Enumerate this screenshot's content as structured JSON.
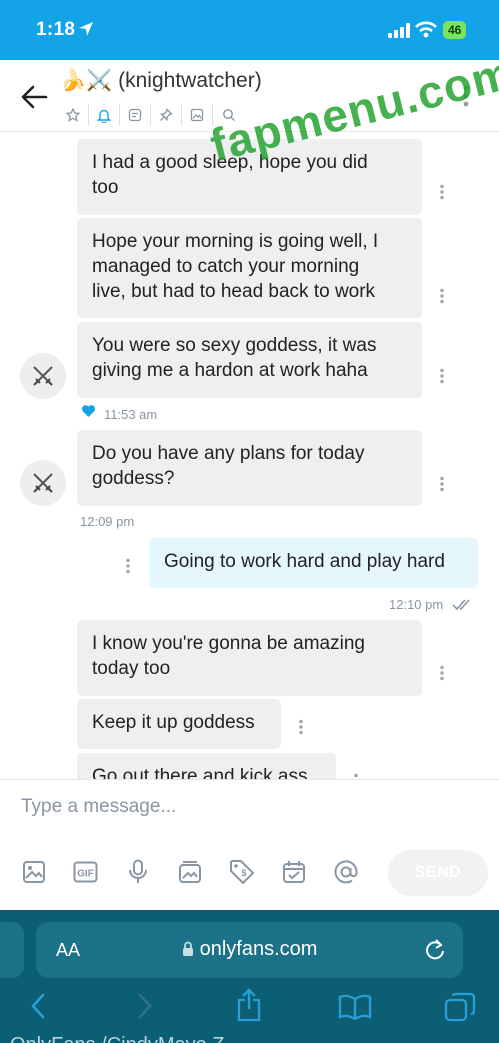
{
  "status": {
    "time": "1:18",
    "network": "46"
  },
  "header": {
    "title": "🍌⚔️ (knightwatcher)"
  },
  "messages": [
    {
      "text_line1": "I had a good sleep, hope you did",
      "text_line2": "too"
    },
    {
      "text_line1": "Hope your morning is going well, I",
      "text_line2": "managed to catch your morning",
      "text_line3": "live, but had to head back to work"
    },
    {
      "text_line1": "You were so sexy goddess, it was",
      "text_line2": "giving me a hardon at work haha"
    },
    {
      "text_line1": "Do you have any plans for today",
      "text_line2": "goddess?"
    },
    {
      "text": "Going to work hard and play hard"
    },
    {
      "text_line1": "I know you're gonna be amazing",
      "text_line2": "today too"
    },
    {
      "text": "Keep it up goddess"
    },
    {
      "text": "Go out there and kick ass"
    }
  ],
  "timestamps": {
    "t1": "11:53 am",
    "t2": "12:09 pm",
    "t3": "12:10 pm"
  },
  "composer": {
    "placeholder": "Type a message...",
    "send_label": "SEND"
  },
  "browser": {
    "aa_label": "AA",
    "url": "onlyfans.com",
    "page_fragment": "OnlyFans          /CindyMayo Z"
  },
  "watermark": "fapmenu.com",
  "colors": {
    "accent": "#12a4e6",
    "liked": "#12a4e6",
    "incoming_bubble": "#efeff1",
    "outgoing_bubble": "#e6f6fd",
    "browser_bar": "#0c5e74",
    "watermark": "#1ca028"
  }
}
